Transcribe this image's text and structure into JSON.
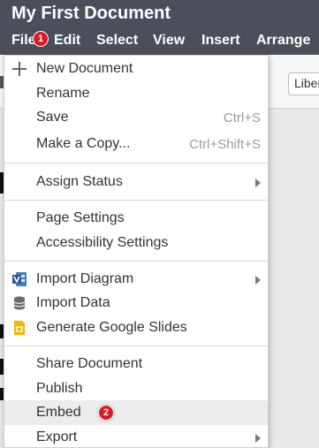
{
  "app": {
    "document_title": "My First Document"
  },
  "menubar": {
    "items": [
      {
        "label": "File"
      },
      {
        "label": "Edit"
      },
      {
        "label": "Select"
      },
      {
        "label": "View"
      },
      {
        "label": "Insert"
      },
      {
        "label": "Arrange"
      }
    ]
  },
  "toolbar": {
    "font_select_value": "Liberation"
  },
  "markers": {
    "one": "1",
    "two": "2"
  },
  "file_menu": {
    "items": [
      {
        "label": "New Document",
        "icon": "plus-icon"
      },
      {
        "label": "Rename"
      },
      {
        "label": "Save",
        "shortcut": "Ctrl+S"
      },
      {
        "label": "Make a Copy...",
        "shortcut": "Ctrl+Shift+S"
      },
      {
        "label": "Assign Status",
        "submenu": true
      },
      {
        "label": "Page Settings"
      },
      {
        "label": "Accessibility Settings"
      },
      {
        "label": "Import Diagram",
        "icon": "visio-icon",
        "submenu": true
      },
      {
        "label": "Import Data",
        "icon": "database-icon"
      },
      {
        "label": "Generate Google Slides",
        "icon": "google-slides-icon"
      },
      {
        "label": "Share Document"
      },
      {
        "label": "Publish"
      },
      {
        "label": "Embed",
        "highlighted": true
      },
      {
        "label": "Export",
        "submenu": true
      }
    ]
  },
  "colors": {
    "header_bg": "#4a4f5a",
    "marker_red": "#d71a26",
    "visio_blue": "#2b579a",
    "slides_yellow": "#f4b400",
    "highlight_bg": "#ececec"
  }
}
